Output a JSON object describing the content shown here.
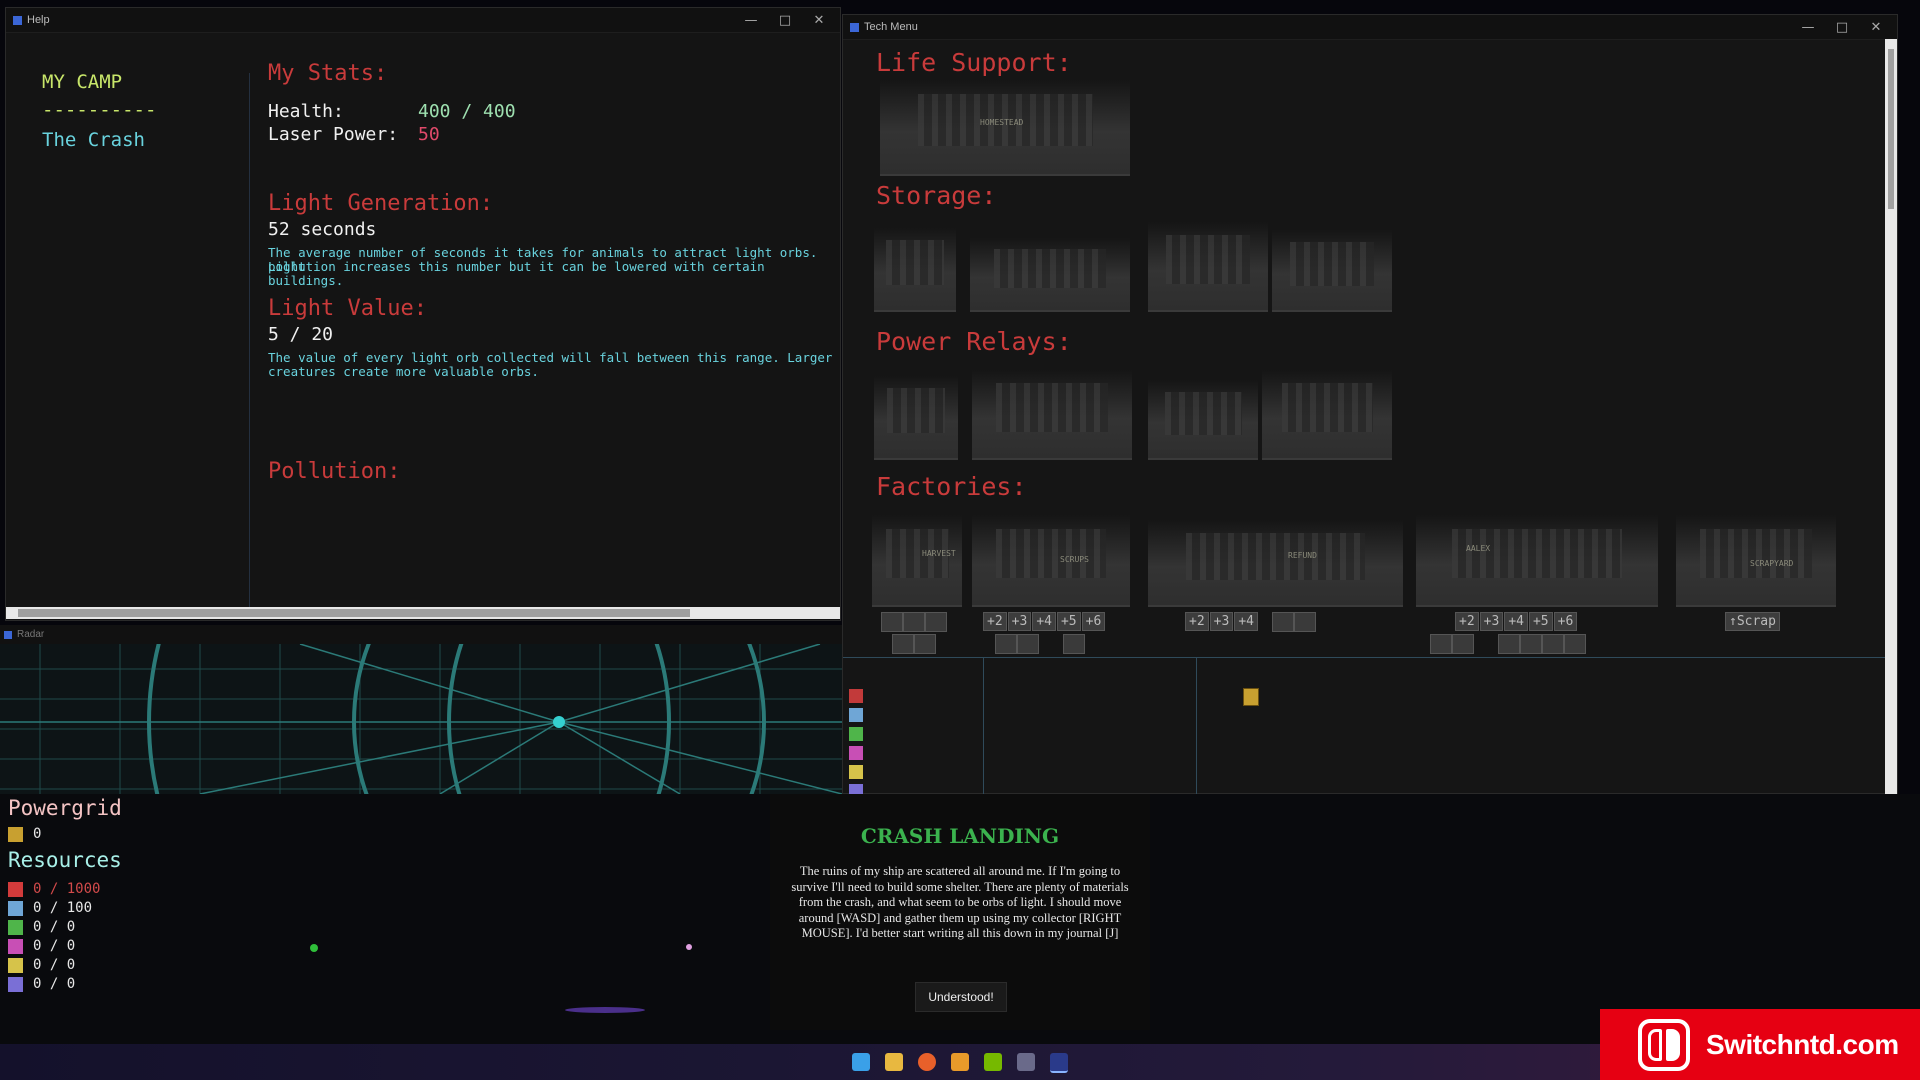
{
  "help_window": {
    "title": "Help",
    "sidebar": {
      "camp": "MY CAMP",
      "divider": "----------",
      "crash": "The Crash"
    },
    "stats_heading": "My Stats:",
    "health_label": "Health:",
    "health_value": "400 / 400",
    "laser_label": "Laser Power:",
    "laser_value": "50",
    "light_gen_heading": "Light Generation:",
    "light_gen_value": "52 seconds",
    "light_gen_desc_1": "The average number of seconds it takes for animals to attract light orbs. Light",
    "light_gen_desc_2": "pollution increases this number but it can be lowered with certain buildings.",
    "light_value_heading": "Light Value:",
    "light_value_value": "5 / 20",
    "light_value_desc_1": "The value of every light orb collected will fall between this range. Larger",
    "light_value_desc_2": "creatures create more valuable orbs.",
    "pollution_heading": "Pollution:"
  },
  "tech_window": {
    "title": "Tech Menu",
    "life_support": "Life Support:",
    "storage": "Storage:",
    "power_relays": "Power Relays:",
    "factories": "Factories:",
    "labels": {
      "homestead": "HOMESTEAD",
      "harvest": "HARVEST",
      "scrups": "SCRUPS",
      "refund": "REFUND",
      "aalex": "AALEX",
      "scrapyard": "SCRAPYARD"
    },
    "level_buttons_a": [
      "+2",
      "+3",
      "+4",
      "+5",
      "+6"
    ],
    "level_buttons_b": [
      "+2",
      "+3",
      "+4"
    ],
    "level_buttons_c": [
      "+2",
      "+3",
      "+4",
      "+5",
      "+6"
    ],
    "scrap_button": "↑Scrap"
  },
  "radar_window": {
    "title": "Radar"
  },
  "hud": {
    "powergrid_title": "Powergrid",
    "powergrid_value": "0",
    "resources_title": "Resources",
    "resources": [
      {
        "icon": "red-crate-icon",
        "color": "#d23b3b",
        "value": "0 / 1000",
        "value_color": "#d24a4a"
      },
      {
        "icon": "blue-cell-icon",
        "color": "#6fa6d6",
        "value": "0 / 100",
        "value_color": "#e8e8e8"
      },
      {
        "icon": "green-tree-icon",
        "color": "#4fb54a",
        "value": "0 / 0",
        "value_color": "#e8e8e8"
      },
      {
        "icon": "pink-gem-icon",
        "color": "#c84fb5",
        "value": "0 / 0",
        "value_color": "#e8e8e8"
      },
      {
        "icon": "yellow-gear-icon",
        "color": "#d6c34a",
        "value": "0 / 0",
        "value_color": "#e8e8e8"
      },
      {
        "icon": "violet-orb-icon",
        "color": "#7a6fd6",
        "value": "0 / 0",
        "value_color": "#e8e8e8"
      }
    ]
  },
  "dialog": {
    "title": "CRASH LANDING",
    "text": "The ruins of my ship are scattered all around me. If I'm going to survive I'll need to build some shelter. There are plenty of materials from the crash, and what seem to be orbs of light. I should move around [WASD] and gather them up using my collector [RIGHT MOUSE]. I'd better start writing all this down in my journal [J]",
    "button": "Understood!"
  },
  "watermark": {
    "text": "Switchntd.com"
  }
}
